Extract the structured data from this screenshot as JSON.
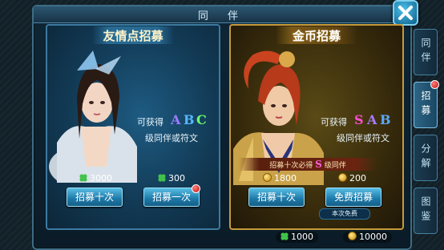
{
  "window": {
    "title": "同 伴"
  },
  "left_panel": {
    "title": "友情点招募",
    "get_prefix": "可获得",
    "grades": [
      "A",
      "B",
      "C"
    ],
    "grade_colors": [
      "#9a7bff",
      "#58b7ff",
      "#6bff6b"
    ],
    "sub_text": "级同伴或符文",
    "cost_ten": "3000",
    "cost_one": "300",
    "btn_ten": "招募十次",
    "btn_one": "招募一次",
    "currency_icon": "clover-icon"
  },
  "right_panel": {
    "title": "金币招募",
    "get_prefix": "可获得",
    "grades": [
      "S",
      "A",
      "B"
    ],
    "grade_colors": [
      "#ff4fd2",
      "#a67bff",
      "#5aa9ff"
    ],
    "sub_text": "级同伴或符文",
    "banner_prefix": "招募十次必得",
    "banner_grade": "S",
    "banner_suffix": "级同伴",
    "cost_ten": "1800",
    "cost_one": "200",
    "btn_ten": "招募十次",
    "btn_one": "免费招募",
    "free_tag": "本次免费",
    "currency_icon": "coin-icon"
  },
  "side_tabs": [
    {
      "label": "同伴",
      "active": false
    },
    {
      "label": "招募",
      "active": true
    },
    {
      "label": "分解",
      "active": false
    },
    {
      "label": "图鉴",
      "active": false
    }
  ],
  "bottom": {
    "friend_points": "1000",
    "gold": "10000"
  }
}
